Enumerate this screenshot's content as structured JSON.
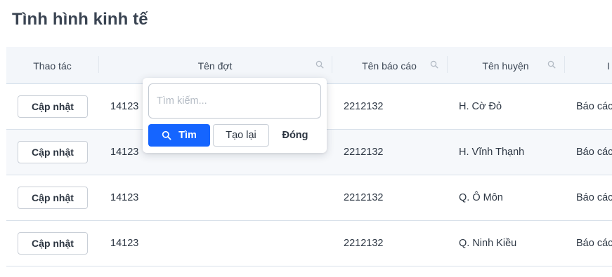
{
  "page": {
    "title": "Tình hình kinh tế"
  },
  "table": {
    "columns": [
      {
        "label": "Thao tác",
        "searchable": false
      },
      {
        "label": "Tên đợt",
        "searchable": true
      },
      {
        "label": "Tên báo cáo",
        "searchable": true
      },
      {
        "label": "Tên huyện",
        "searchable": true
      },
      {
        "label": "I",
        "searchable": false
      }
    ],
    "update_label": "Cập nhật",
    "rows": [
      {
        "batch": "14123",
        "report": "2212132",
        "district": "H. Cờ Đỏ",
        "extra": "Báo các"
      },
      {
        "batch": "14123",
        "report": "2212132",
        "district": "H. Vĩnh Thạnh",
        "extra": "Báo các"
      },
      {
        "batch": "14123",
        "report": "2212132",
        "district": "Q. Ô Môn",
        "extra": "Báo các"
      },
      {
        "batch": "14123",
        "report": "2212132",
        "district": "Q. Ninh Kiều",
        "extra": "Báo các"
      }
    ]
  },
  "filter_popup": {
    "placeholder": "Tìm kiếm...",
    "search_label": "Tìm",
    "reset_label": "Tạo lại",
    "close_label": "Đóng"
  },
  "icons": {
    "column_search": "search-icon",
    "button_search": "search-icon"
  },
  "colors": {
    "primary": "#1565ff",
    "header_bg": "#f3f6fa",
    "title": "#3a4452"
  }
}
